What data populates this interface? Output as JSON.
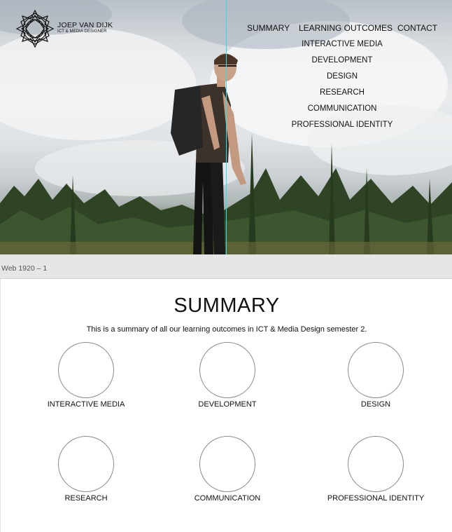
{
  "brand": {
    "name": "JOEP VAN DIJK",
    "subtitle": "ICT & MEDIA DESIGNER"
  },
  "nav": {
    "items": [
      {
        "label": "SUMMARY"
      },
      {
        "label": "LEARNING OUTCOMES"
      },
      {
        "label": "CONTACT"
      }
    ],
    "dropdown": [
      {
        "label": "INTERACTIVE MEDIA"
      },
      {
        "label": "DEVELOPMENT"
      },
      {
        "label": "DESIGN"
      },
      {
        "label": "RESEARCH"
      },
      {
        "label": "COMMUNICATION"
      },
      {
        "label": "PROFESSIONAL IDENTITY"
      }
    ]
  },
  "artboard": {
    "label": "Web 1920 – 1"
  },
  "summary": {
    "title": "SUMMARY",
    "intro": "This is a summary of all our learning outcomes in ICT & Media Design semester 2.",
    "outcomes": [
      {
        "label": "INTERACTIVE MEDIA"
      },
      {
        "label": "DEVELOPMENT"
      },
      {
        "label": "DESIGN"
      },
      {
        "label": "RESEARCH"
      },
      {
        "label": "COMMUNICATION"
      },
      {
        "label": "PROFESSIONAL IDENTITY"
      }
    ]
  },
  "colors": {
    "guide_line": "#2ee0e6",
    "text": "#111111",
    "artboard_bar": "#e6e6e6"
  }
}
